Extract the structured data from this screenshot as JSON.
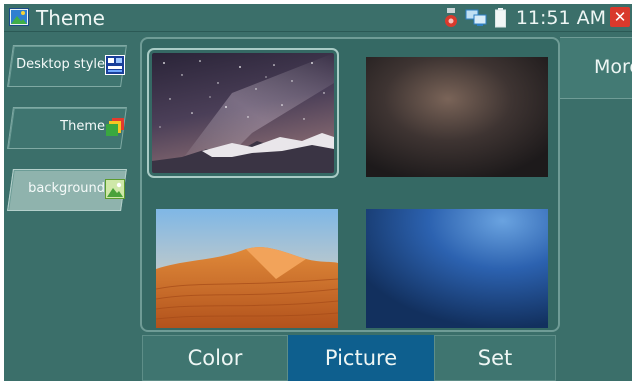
{
  "statusbar": {
    "title": "Theme",
    "time": "11:51 AM",
    "icons": [
      "image-app-icon",
      "alarm-icon",
      "network-icon",
      "battery-icon",
      "close-icon"
    ]
  },
  "sidebar": {
    "items": [
      {
        "label": "Desktop style",
        "icon": "desktop-style-icon",
        "active": false
      },
      {
        "label": "Theme",
        "icon": "theme-icon",
        "active": false
      },
      {
        "label": "background",
        "icon": "background-image-icon",
        "active": true
      }
    ]
  },
  "wallpapers": [
    {
      "name": "starry-night-mountain",
      "selected": true
    },
    {
      "name": "dark-blur",
      "selected": false
    },
    {
      "name": "desert-dunes",
      "selected": false
    },
    {
      "name": "blue-gradient",
      "selected": false
    }
  ],
  "right": {
    "more_label": "More"
  },
  "tabs": [
    {
      "label": "Color",
      "active": false
    },
    {
      "label": "Picture",
      "active": true
    },
    {
      "label": "Set",
      "active": false
    }
  ],
  "colors": {
    "background": "#3b6f6a",
    "active_tab": "#0e5f8e",
    "close": "#d9392c"
  }
}
